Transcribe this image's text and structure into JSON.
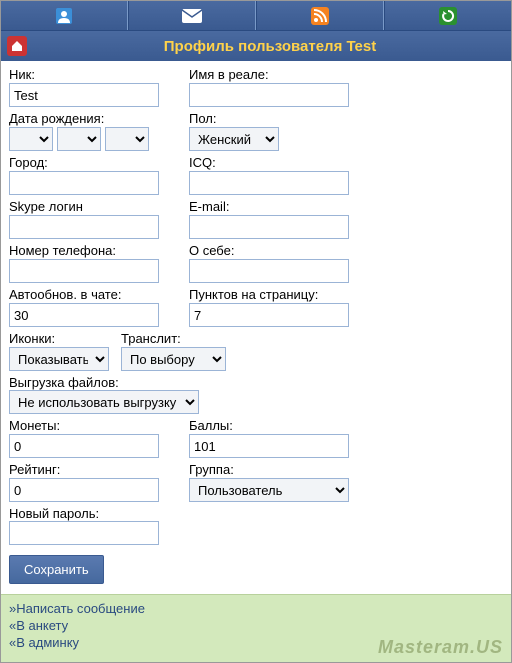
{
  "header": {
    "title": "Профиль пользователя Test"
  },
  "labels": {
    "nick": "Ник:",
    "realname": "Имя в реале:",
    "dob": "Дата рождения:",
    "gender": "Пол:",
    "city": "Город:",
    "icq": "ICQ:",
    "skype": "Skype логин",
    "email": "E-mail:",
    "phone": "Номер телефона:",
    "about": "О себе:",
    "autorefresh": "Автообнов. в чате:",
    "perpage": "Пунктов на страницу:",
    "icons": "Иконки:",
    "translit": "Транслит:",
    "upload": "Выгрузка файлов:",
    "coins": "Монеты:",
    "points": "Баллы:",
    "rating": "Рейтинг:",
    "group": "Группа:",
    "newpassword": "Новый пароль:"
  },
  "values": {
    "nick": "Test",
    "realname": "",
    "gender": "Женский",
    "city": "",
    "icq": "",
    "skype": "",
    "email": "",
    "phone": "",
    "about": "",
    "autorefresh": "30",
    "perpage": "7",
    "icons": "Показывать",
    "translit": "По выбору",
    "upload": "Не использовать выгрузку",
    "coins": "0",
    "points": "101",
    "rating": "0",
    "group": "Пользователь",
    "newpassword": ""
  },
  "buttons": {
    "save": "Сохранить"
  },
  "footer": {
    "link1": "Написать сообщение",
    "link2": "В анкету",
    "link3": "В админку",
    "watermark": "Masteram.US"
  }
}
